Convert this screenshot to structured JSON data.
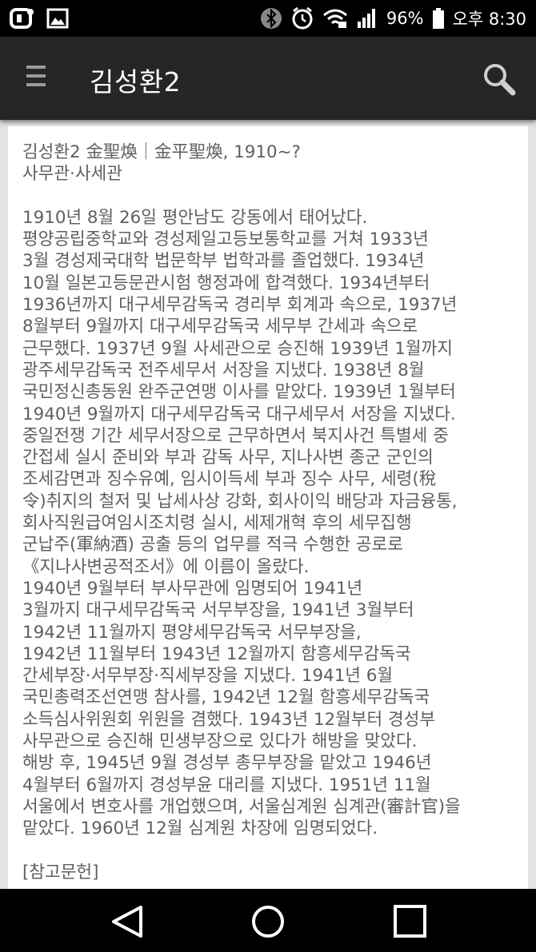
{
  "status_bar": {
    "icons_left": [
      "uplus-icon",
      "gallery-icon"
    ],
    "icons_right": [
      "bluetooth-icon",
      "alarm-icon",
      "wifi-icon",
      "signal-icon",
      "battery-icon"
    ],
    "battery_percent": "96%",
    "time": "오후 8:30"
  },
  "app_bar": {
    "title": "김성환2",
    "menu_icon": "hamburger-menu-icon",
    "search_icon": "search-icon"
  },
  "article": {
    "header_lines": [
      "김성환2 金聖煥｜金平聖煥, 1910~?",
      "사무관·사세관"
    ],
    "body_lines": [
      "1910년 8월 26일 평안남도 강동에서 태어났다.",
      "평양공립중학교와 경성제일고등보통학교를 거쳐 1933년",
      "3월 경성제국대학 법문학부 법학과를 졸업했다. 1934년",
      "10월 일본고등문관시험 행정과에 합격했다. 1934년부터",
      "1936년까지 대구세무감독국 경리부 회계과 속으로, 1937년",
      "8월부터 9월까지 대구세무감독국 세무부 간세과 속으로",
      "근무했다. 1937년 9월 사세관으로 승진해 1939년 1월까지",
      "광주세무감독국 전주세무서 서장을 지냈다. 1938년 8월",
      "국민정신총동원 완주군연맹 이사를 맡았다. 1939년 1월부터",
      "1940년 9월까지 대구세무감독국 대구세무서 서장을 지냈다.",
      "중일전쟁 기간 세무서장으로 근무하면서 북지사건 특별세 중",
      "간접세 실시 준비와 부과 감독 사무, 지나사변 종군 군인의",
      "조세감면과 징수유예, 임시이득세 부과 징수 사무, 세령(稅",
      "令)취지의 철저 및 납세사상 강화, 회사이익 배당과 자금융통,",
      "회사직원급여임시조치령 실시, 세제개혁 후의 세무집행",
      "군납주(軍納酒) 공출 등의 업무를 적극 수행한 공로로",
      "《지나사변공적조서》에 이름이 올랐다.",
      "1940년 9월부터 부사무관에 임명되어 1941년",
      "3월까지 대구세무감독국 서무부장을, 1941년 3월부터",
      "1942년 11월까지 평양세무감독국 서무부장을,",
      "1942년 11월부터 1943년 12월까지 함흥세무감독국",
      "간세부장·서무부장·직세부장을 지냈다. 1941년 6월",
      "국민총력조선연맹 참사를, 1942년 12월 함흥세무감독국",
      "소득심사위원회 위원을 겸했다. 1943년 12월부터 경성부",
      "사무관으로 승진해 민생부장으로 있다가 해방을 맞았다.",
      "해방 후, 1945년 9월 경성부 총무부장을 맡았고 1946년",
      "4월부터 6월까지 경성부윤 대리를 지냈다. 1951년 11월",
      "서울에서 변호사를 개업했으며, 서울심계원 심계관(審計官)을",
      "맡았다. 1960년 12월 심계원 차장에 임명되었다."
    ],
    "references_heading": "[참고문헌]"
  },
  "nav_bar": {
    "back_icon": "back-triangle-icon",
    "home_icon": "home-circle-icon",
    "recents_icon": "recents-square-icon"
  }
}
